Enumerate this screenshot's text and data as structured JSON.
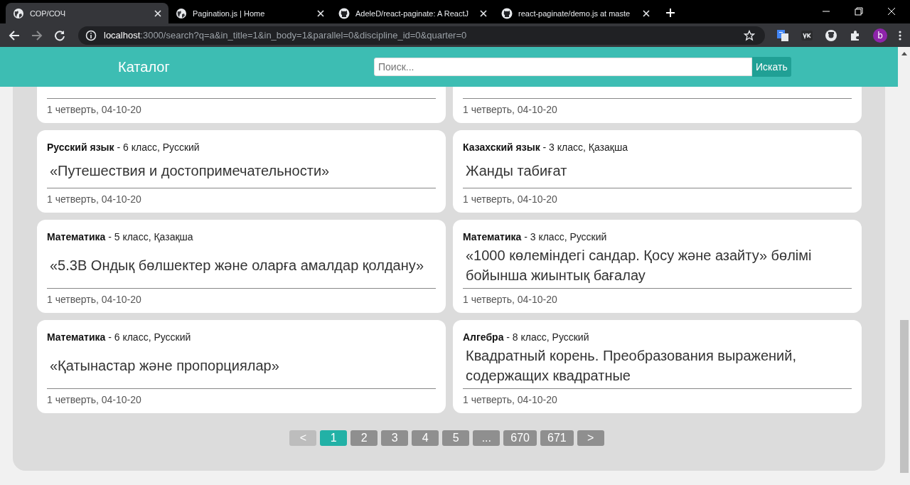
{
  "browser": {
    "tabs": [
      {
        "title": "СОР/СОЧ",
        "kind": "site",
        "selected": true
      },
      {
        "title": "Pagination.js | Home",
        "kind": "site",
        "selected": false
      },
      {
        "title": "AdeleD/react-paginate: A ReactJ",
        "kind": "repo",
        "selected": false
      },
      {
        "title": "react-paginate/demo.js at maste",
        "kind": "repo",
        "selected": false
      }
    ],
    "url_host": "localhost",
    "url_path": ":3000/search?q=a&in_title=1&in_body=1&parallel=0&discipline_id=0&quarter=0",
    "profile_initial": "b"
  },
  "header": {
    "title": "Каталог",
    "search": {
      "placeholder": "Поиск..."
    },
    "search_button": "Искать"
  },
  "cards": [
    {
      "footer": "1 четверть, 04-10-20"
    },
    {
      "footer": "1 четверть, 04-10-20"
    },
    {
      "meta": "**Русский язык** - 6 класс, Русский",
      "title": "«Путешествия и достопримечательности»",
      "footer": "1 четверть, 04-10-20"
    },
    {
      "meta": "**Казахский язык** - 3 класс, Қазақша",
      "title": "Жанды табиғат",
      "footer": "1 четверть, 04-10-20"
    },
    {
      "meta": "**Математика** - 5 класс, Қазақша",
      "title": "«5.3В Ондық бөлшектер және оларға амалдар қолдану»",
      "footer": "1 четверть, 04-10-20"
    },
    {
      "meta": "**Математика** - 3 класс, Русский",
      "title": "«1000 көлеміндегі сандар. Қосу және азайту» бөлімі бойынша жиынтық бағалау",
      "footer": "1 четверть, 04-10-20"
    },
    {
      "meta": "**Математика** - 6 класс, Русский",
      "title": "«Қатынастар және пропорциялар»",
      "footer": "1 четверть, 04-10-20"
    },
    {
      "meta": "**Алгебра** - 8 класс, Русский",
      "title": "Квадратный корень. Преобразования выражений, содержащих квадратные",
      "footer": "1 четверть, 04-10-20"
    }
  ],
  "pagination": [
    {
      "label": "<",
      "selected": false,
      "disabled": true
    },
    {
      "label": "1",
      "selected": true,
      "disabled": false
    },
    {
      "label": "2",
      "selected": false,
      "disabled": false
    },
    {
      "label": "3",
      "selected": false,
      "disabled": false
    },
    {
      "label": "4",
      "selected": false,
      "disabled": false
    },
    {
      "label": "5",
      "selected": false,
      "disabled": false
    },
    {
      "label": "...",
      "selected": false,
      "disabled": false
    },
    {
      "label": "670",
      "selected": false,
      "disabled": false
    },
    {
      "label": "671",
      "selected": false,
      "disabled": false
    },
    {
      "label": ">",
      "selected": false,
      "disabled": false
    }
  ]
}
